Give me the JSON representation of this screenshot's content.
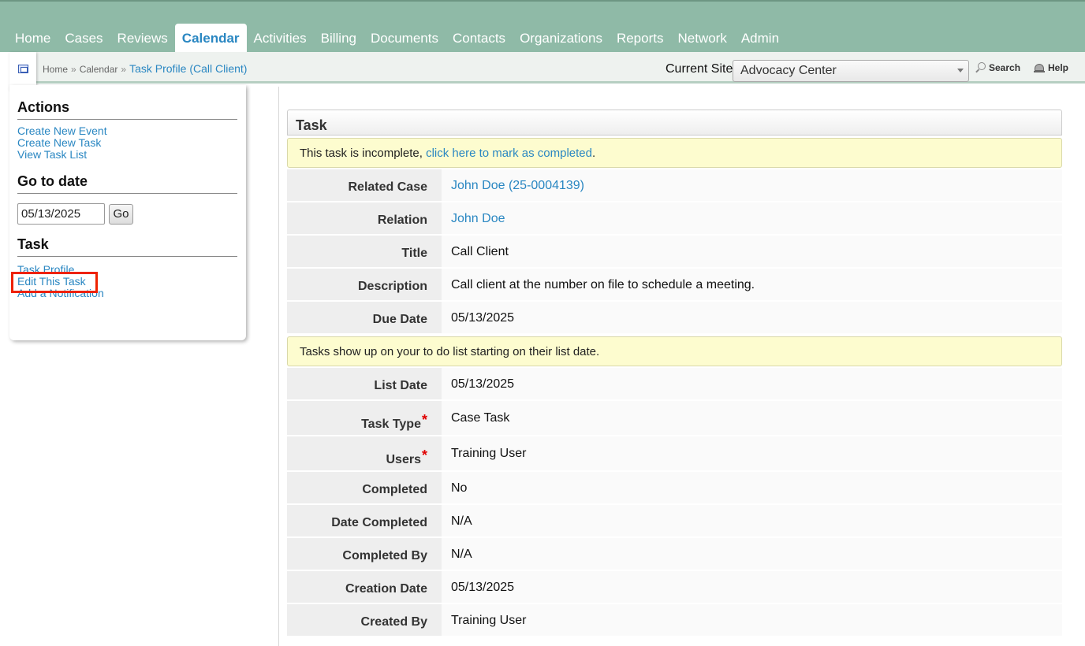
{
  "nav": {
    "items": [
      "Home",
      "Cases",
      "Reviews",
      "Calendar",
      "Activities",
      "Billing",
      "Documents",
      "Contacts",
      "Organizations",
      "Reports",
      "Network",
      "Admin"
    ],
    "active": "Calendar"
  },
  "breadcrumb": {
    "home": "Home",
    "sep": "»",
    "calendar": "Calendar",
    "current": "Task Profile (Call Client)"
  },
  "site": {
    "label": "Current Site",
    "selected": "Advocacy Center"
  },
  "tools": {
    "search": "Search",
    "help": "Help"
  },
  "sidebar": {
    "actions_title": "Actions",
    "actions": [
      "Create New Event",
      "Create New Task",
      "View Task List"
    ],
    "goto_title": "Go to date",
    "date_value": "05/13/2025",
    "go_label": "Go",
    "task_title": "Task",
    "task_links": [
      "Task Profile",
      "Edit This Task",
      "Add a Notification"
    ]
  },
  "task": {
    "heading": "Task",
    "incomplete_prefix": "This task is incomplete, ",
    "incomplete_link": "click here to mark as completed",
    "incomplete_suffix": ".",
    "list_notice": "Tasks show up on your to do list starting on their list date.",
    "fields": {
      "related_case": {
        "label": "Related Case",
        "value": "John Doe (25-0004139)"
      },
      "relation": {
        "label": "Relation",
        "value": "John Doe"
      },
      "title": {
        "label": "Title",
        "value": "Call Client"
      },
      "description": {
        "label": "Description",
        "value": "Call client at the number on file to schedule a meeting."
      },
      "due_date": {
        "label": "Due Date",
        "value": "05/13/2025"
      },
      "list_date": {
        "label": "List Date",
        "value": "05/13/2025"
      },
      "task_type": {
        "label": "Task Type",
        "value": "Case Task"
      },
      "users": {
        "label": "Users",
        "value": "Training User"
      },
      "completed": {
        "label": "Completed",
        "value": "No"
      },
      "date_completed": {
        "label": "Date Completed",
        "value": "N/A"
      },
      "completed_by": {
        "label": "Completed By",
        "value": "N/A"
      },
      "creation_date": {
        "label": "Creation Date",
        "value": "05/13/2025"
      },
      "created_by": {
        "label": "Created By",
        "value": "Training User"
      }
    },
    "required_marker": "*"
  }
}
